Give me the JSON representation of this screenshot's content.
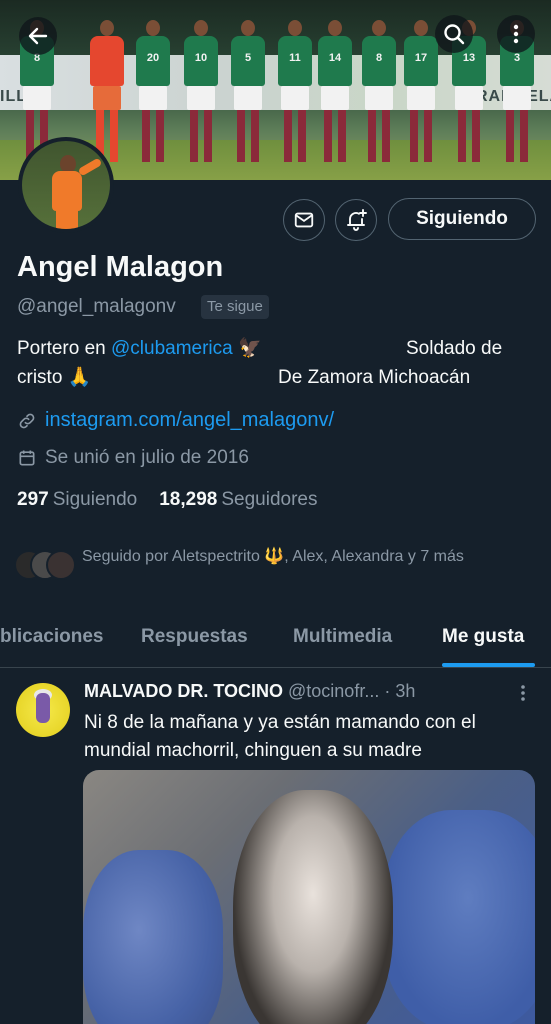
{
  "banner": {
    "board_text_left": "ILL",
    "board_text_right": "RANGELA",
    "jersey_numbers": [
      "8",
      "",
      "20",
      "10",
      "5",
      "11",
      "14",
      "8",
      "17",
      "13",
      "3"
    ]
  },
  "top_bar": {
    "back_icon": "arrow-left-icon",
    "search_icon": "search-icon",
    "more_icon": "more-vertical-icon"
  },
  "profile": {
    "name": "Angel Malagon",
    "handle": "@angel_malagonv",
    "follows_you": "Te sigue",
    "bio_line1_prefix": "Portero en ",
    "bio_link": "@clubamerica",
    "bio_eagle": "🦅",
    "bio_line1_right": "Soldado de",
    "bio_line2_left": "cristo 🙏",
    "bio_line2_right": "De Zamora Michoacán",
    "website": "instagram.com/angel_malagonv/",
    "joined": "Se unió en julio de 2016",
    "following_count": "297",
    "following_label": "Siguiendo",
    "followers_count": "18,298",
    "followers_label": "Seguidores",
    "followed_by": "Seguido por Aletspectrito 🔱, Alex, Alexandra y 7 más",
    "follow_button": "Siguiendo"
  },
  "tabs": [
    {
      "label": "blicaciones"
    },
    {
      "label": "Respuestas"
    },
    {
      "label": "Multimedia"
    },
    {
      "label": "Me gusta"
    }
  ],
  "tweet": {
    "author_name": "MALVADO DR. TOCINO",
    "author_handle": "@tocinofr...",
    "time": "· 3h",
    "text": "Ni 8 de la mañana y ya están mamando con el mundial machorril, chinguen a su madre"
  },
  "colors": {
    "background": "#15202b",
    "accent": "#1d9bf0",
    "muted": "#8b98a5"
  }
}
